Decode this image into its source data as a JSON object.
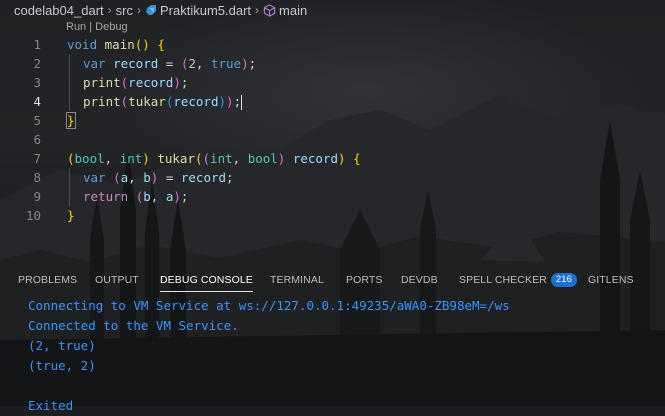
{
  "breadcrumb": {
    "items": [
      "codelab04_dart",
      "src",
      "Praktikum5.dart",
      "main"
    ],
    "icons": [
      "chevron-right-icon",
      "dart-file-icon",
      "cube-icon"
    ]
  },
  "editor": {
    "codelens": "Run | Debug",
    "active_line": 4,
    "line_numbers": [
      "1",
      "2",
      "3",
      "4",
      "5",
      "6",
      "7",
      "8",
      "9",
      "10"
    ],
    "lines": [
      [
        [
          "void",
          "kw"
        ],
        [
          " ",
          "p"
        ],
        [
          "main",
          "fn"
        ],
        [
          "()",
          "b1"
        ],
        [
          " ",
          "p"
        ],
        [
          "{",
          "b1"
        ]
      ],
      [
        [
          "var",
          "kw"
        ],
        [
          " ",
          "p"
        ],
        [
          "record",
          "var"
        ],
        [
          " = ",
          "p"
        ],
        [
          "(",
          "b2"
        ],
        [
          "2",
          "num"
        ],
        [
          ", ",
          "p"
        ],
        [
          "true",
          "kw"
        ],
        [
          ")",
          "b2"
        ],
        [
          ";",
          "p"
        ]
      ],
      [
        [
          "print",
          "fn"
        ],
        [
          "(",
          "b2"
        ],
        [
          "record",
          "var"
        ],
        [
          ")",
          "b2"
        ],
        [
          ";",
          "p"
        ]
      ],
      [
        [
          "print",
          "fn"
        ],
        [
          "(",
          "b2"
        ],
        [
          "tukar",
          "fn"
        ],
        [
          "(",
          "b3"
        ],
        [
          "record",
          "var"
        ],
        [
          ")",
          "b3"
        ],
        [
          ")",
          "b2"
        ],
        [
          ";",
          "p"
        ]
      ],
      [
        [
          "}",
          "b1"
        ]
      ],
      [],
      [
        [
          "(",
          "b1"
        ],
        [
          "bool",
          "typ"
        ],
        [
          ", ",
          "p"
        ],
        [
          "int",
          "typ"
        ],
        [
          ")",
          "b1"
        ],
        [
          " ",
          "p"
        ],
        [
          "tukar",
          "fn"
        ],
        [
          "(",
          "b1"
        ],
        [
          "(",
          "b2"
        ],
        [
          "int",
          "typ"
        ],
        [
          ", ",
          "p"
        ],
        [
          "bool",
          "typ"
        ],
        [
          ")",
          "b2"
        ],
        [
          " ",
          "p"
        ],
        [
          "record",
          "var"
        ],
        [
          ")",
          "b1"
        ],
        [
          " ",
          "p"
        ],
        [
          "{",
          "b1"
        ]
      ],
      [
        [
          "var",
          "kw"
        ],
        [
          " ",
          "p"
        ],
        [
          "(",
          "b2"
        ],
        [
          "a",
          "var"
        ],
        [
          ", ",
          "p"
        ],
        [
          "b",
          "var"
        ],
        [
          ")",
          "b2"
        ],
        [
          " = ",
          "p"
        ],
        [
          "record",
          "var"
        ],
        [
          ";",
          "p"
        ]
      ],
      [
        [
          "return",
          "ctl"
        ],
        [
          " ",
          "p"
        ],
        [
          "(",
          "b2"
        ],
        [
          "b",
          "var"
        ],
        [
          ", ",
          "p"
        ],
        [
          "a",
          "var"
        ],
        [
          ")",
          "b2"
        ],
        [
          ";",
          "p"
        ]
      ],
      [
        [
          "}",
          "b1"
        ]
      ]
    ]
  },
  "panel": {
    "tabs": [
      "PROBLEMS",
      "OUTPUT",
      "DEBUG CONSOLE",
      "TERMINAL",
      "PORTS",
      "DEVDB",
      "SPELL CHECKER",
      "GITLENS"
    ],
    "active_tab": "DEBUG CONSOLE",
    "spell_checker_count": "216",
    "console_lines": [
      "Connecting to VM Service at ws://127.0.0.1:49235/aWA0-ZB98eM=/ws",
      "Connected to the VM Service.",
      "(2, true)",
      "(true, 2)",
      "",
      "Exited"
    ]
  },
  "colors": {
    "keyword": "#569cd6",
    "control": "#c586c0",
    "function": "#dcdcaa",
    "variable": "#9cdcfe",
    "type": "#4ec9b0",
    "number": "#b5cea8",
    "console_text": "#3794ff",
    "badge": "#1f6fd1"
  }
}
